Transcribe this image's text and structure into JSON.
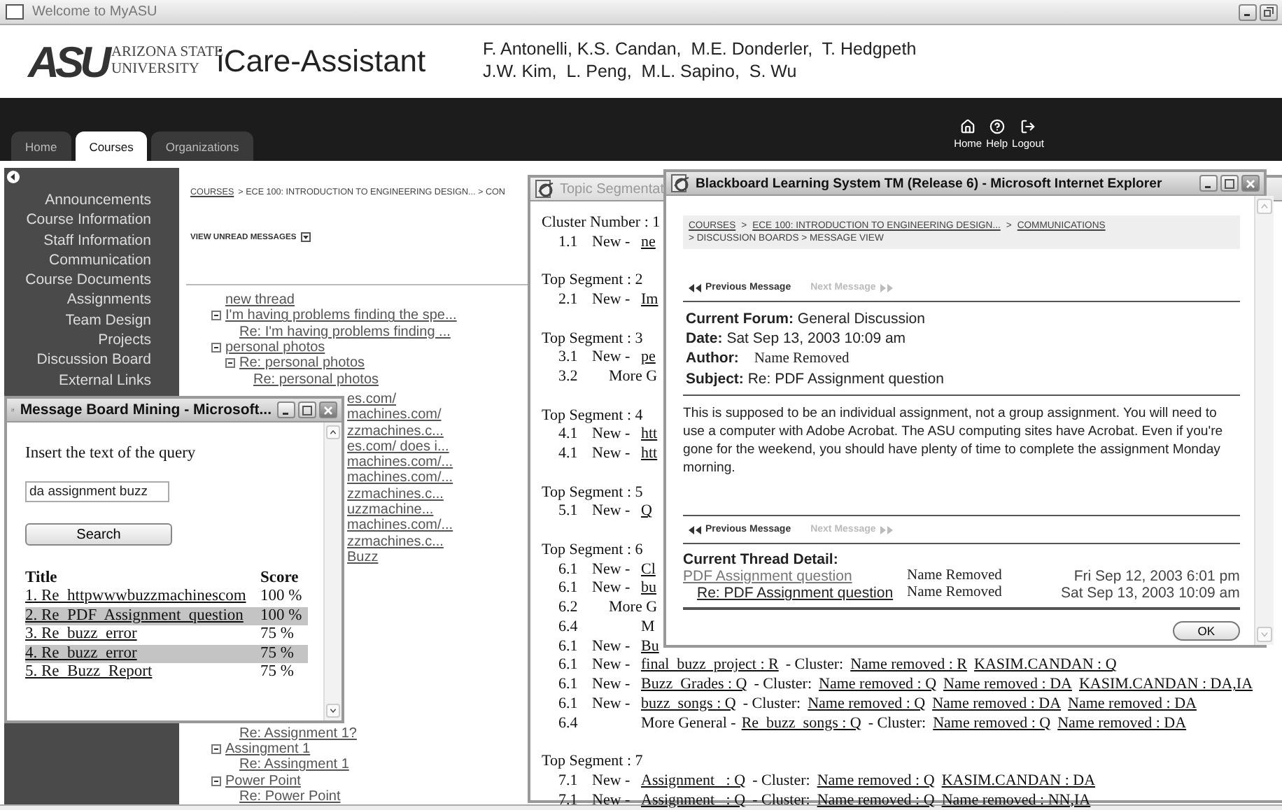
{
  "window": {
    "title": "Welcome to MyASU"
  },
  "header": {
    "logo": {
      "mark": "ASU",
      "lines": [
        "ARIZONA STATE",
        "UNIVERSITY"
      ]
    },
    "app_title": "iCare-Assistant",
    "authors": [
      "F. Antonelli, K.S. Candan,  M.E. Donderler,  T. Hedgpeth",
      "J.W. Kim,  L. Peng,  M.L. Sapino,  S. Wu"
    ]
  },
  "nav": {
    "tabs": [
      {
        "label": "Home",
        "selected": false
      },
      {
        "label": "Courses",
        "selected": true
      },
      {
        "label": "Organizations",
        "selected": false
      }
    ],
    "links": [
      {
        "kind": "home",
        "label": "Home"
      },
      {
        "kind": "help",
        "label": "Help"
      },
      {
        "kind": "logout",
        "label": "Logout"
      }
    ]
  },
  "sidebar": {
    "items": [
      "Announcements",
      "Course Information",
      "Staff Information",
      "Communication",
      "Course Documents",
      "Assignments",
      "Team Design Projects",
      "Discussion Board",
      "External Links"
    ]
  },
  "content": {
    "breadcrumb": [
      {
        "text": "COURSES",
        "link": true
      },
      {
        "text": "> ECE 100: INTRODUCTION TO ENGINEERING DESIGN... > CON",
        "link": false
      }
    ],
    "view_unread": "VIEW UNREAD MESSAGES",
    "threads": [
      {
        "text": "new thread"
      },
      {
        "text": "I'm having problems finding the spe...",
        "expanded": true,
        "children": [
          {
            "text": "Re: I'm having problems finding ..."
          }
        ]
      },
      {
        "text": "personal photos",
        "expanded": true,
        "children": [
          {
            "text": "Re: personal photos",
            "expanded": true,
            "children": [
              {
                "text": "Re: personal photos"
              }
            ]
          }
        ]
      }
    ],
    "cut_rows": [
      "es.com/",
      "machines.com/",
      "zzmachines.c...",
      "es.com/ does i...",
      "machines.com/...",
      "machines.com/...",
      "zzmachines.c...",
      "uzzmachine...",
      "machines.com/...",
      "zzmachines.c...",
      "Buzz"
    ],
    "continued_replies": [
      "Re: Assignment 1?"
    ],
    "bottom_threads": [
      {
        "text": "Assingment 1",
        "expanded": true,
        "children": [
          {
            "text": "Re: Assingment 1"
          }
        ]
      },
      {
        "text": "Power Point",
        "expanded": true,
        "children": [
          {
            "text": "Re: Power Point"
          }
        ]
      }
    ]
  },
  "topic_window": {
    "title": "Topic Segmentat",
    "rows": [
      {
        "kind": "heading",
        "text": "Cluster Number : 1"
      },
      {
        "kind": "new",
        "number": "1.1",
        "label": "New -",
        "parts": [
          {
            "text": "ne",
            "link": true
          }
        ]
      },
      {
        "kind": "heading",
        "text": "Top Segment : 2"
      },
      {
        "kind": "new",
        "number": "2.1",
        "label": "New -",
        "parts": [
          {
            "text": "Im",
            "link": true
          }
        ]
      },
      {
        "kind": "heading",
        "text": "Top Segment : 3"
      },
      {
        "kind": "new",
        "number": "3.1",
        "label": "New -",
        "parts": [
          {
            "text": "pe",
            "link": true
          }
        ]
      },
      {
        "kind": "more",
        "number": "3.2",
        "label": "More G"
      },
      {
        "kind": "heading",
        "text": "Top Segment : 4"
      },
      {
        "kind": "new",
        "number": "4.1",
        "label": "New -",
        "parts": [
          {
            "text": "htt",
            "link": true
          }
        ]
      },
      {
        "kind": "new",
        "number": "4.1",
        "label": "New -",
        "parts": [
          {
            "text": "htt",
            "link": true
          }
        ]
      },
      {
        "kind": "heading",
        "text": "Top Segment : 5"
      },
      {
        "kind": "new",
        "number": "5.1",
        "label": "New -",
        "parts": [
          {
            "text": "Q",
            "link": true
          }
        ]
      },
      {
        "kind": "heading",
        "text": "Top Segment : 6"
      },
      {
        "kind": "new",
        "number": "6.1",
        "label": "New -",
        "parts": [
          {
            "text": "Cl",
            "link": true
          }
        ]
      },
      {
        "kind": "new",
        "number": "6.1",
        "label": "New -",
        "parts": [
          {
            "text": "bu",
            "link": true
          }
        ]
      },
      {
        "kind": "more",
        "number": "6.2",
        "label": "More G"
      },
      {
        "kind": "general",
        "number": "6.4",
        "label": "M"
      },
      {
        "kind": "new",
        "number": "6.1",
        "label": "New -",
        "parts": [
          {
            "text": "Bu",
            "link": true
          }
        ]
      },
      {
        "kind": "new",
        "number": "6.1",
        "label": "New -",
        "parts": [
          {
            "text": "final  buzz  project : R",
            "link": true
          },
          {
            "text": "- Cluster:",
            "link": false
          },
          {
            "text": "Name removed : R",
            "link": true
          },
          {
            "text": "KASIM.CANDAN : Q",
            "link": true
          }
        ]
      },
      {
        "kind": "new",
        "number": "6.1",
        "label": "New -",
        "parts": [
          {
            "text": "Buzz  Grades : Q",
            "link": true
          },
          {
            "text": "- Cluster:",
            "link": false
          },
          {
            "text": "Name removed : Q",
            "link": true
          },
          {
            "text": "Name removed : DA",
            "link": true
          },
          {
            "text": "KASIM.CANDAN : DA,IA",
            "link": true
          }
        ]
      },
      {
        "kind": "new",
        "number": "6.1",
        "label": "New -",
        "parts": [
          {
            "text": "buzz  songs : Q",
            "link": true
          },
          {
            "text": "- Cluster:",
            "link": false
          },
          {
            "text": "Name removed : Q",
            "link": true
          },
          {
            "text": "Name removed : DA",
            "link": true
          },
          {
            "text": "Name removed : DA",
            "link": true
          }
        ]
      },
      {
        "kind": "general",
        "number": "6.4",
        "label": "More General -",
        "parts": [
          {
            "text": "Re  buzz  songs : Q",
            "link": true
          },
          {
            "text": "- Cluster:",
            "link": false
          },
          {
            "text": "Name removed : Q",
            "link": true
          },
          {
            "text": "Name removed : DA",
            "link": true
          }
        ]
      },
      {
        "kind": "heading",
        "text": "Top Segment : 7"
      },
      {
        "kind": "new",
        "number": "7.1",
        "label": "New -",
        "parts": [
          {
            "text": "Assignment   : Q",
            "link": true
          },
          {
            "text": "- Cluster:",
            "link": false
          },
          {
            "text": "Name removed : Q",
            "link": true
          },
          {
            "text": "KASIM.CANDAN : DA",
            "link": true
          }
        ]
      },
      {
        "kind": "new",
        "number": "7.1",
        "label": "New -",
        "parts": [
          {
            "text": "Assignment   : Q",
            "link": true
          },
          {
            "text": "- Cluster:",
            "link": false
          },
          {
            "text": "Name removed : Q",
            "link": true
          },
          {
            "text": "Name removed : NN,IA",
            "link": true
          }
        ]
      }
    ]
  },
  "message_window": {
    "title": "Blackboard Learning System TM (Release 6) - Microsoft Internet Explorer",
    "breadcrumb": [
      {
        "text": "COURSES",
        "link": true
      },
      {
        "text": ">",
        "link": false
      },
      {
        "text": "ECE 100: INTRODUCTION TO ENGINEERING DESIGN...",
        "link": true
      },
      {
        "text": ">",
        "link": false
      },
      {
        "text": "COMMUNICATIONS",
        "link": true
      },
      {
        "text": "> DISCUSSION BOARDS > MESSAGE VIEW",
        "link": false
      }
    ],
    "pager_top": [
      {
        "kind": "previous",
        "label": "Previous Message",
        "disabled": false
      },
      {
        "kind": "next",
        "label": "Next Message",
        "disabled": true
      }
    ],
    "fields": [
      {
        "label": "Current Forum:",
        "value": "General Discussion"
      },
      {
        "label": "Date:",
        "value": "Sat Sep 13, 2003 10:09 am"
      },
      {
        "label": "Author:",
        "value": "Name Removed"
      },
      {
        "label": "Subject:",
        "value": "Re: PDF Assignment question"
      }
    ],
    "body": "This is supposed to be an individual assignment, not a group assignment. You will need to use a computer with Adobe Acrobat. The ASU computing sites have Acrobat. Even if you're gone for the weekend, you should have plenty of time to complete the assignment Monday morning.",
    "pager_bottom": [
      {
        "kind": "previous",
        "label": "Previous Message",
        "disabled": false
      },
      {
        "kind": "next",
        "label": "Next Message",
        "disabled": true
      }
    ],
    "thread_heading": "Current Thread Detail:",
    "thread": [
      {
        "title": "PDF Assignment question",
        "author": "Name Removed",
        "date": "Fri Sep 12, 2003 6:01 pm",
        "reply": false,
        "current": false
      },
      {
        "title": "Re: PDF Assignment question",
        "author": "Name Removed",
        "date": "Sat Sep 13, 2003 10:09 am",
        "reply": true,
        "current": true
      }
    ],
    "ok_button": "OK"
  },
  "mining_window": {
    "title": "Message Board Mining - Microsoft...",
    "prompt": "Insert the text of the query",
    "query": "da assignment buzz",
    "search_button": "Search",
    "columns": [
      "Title",
      "Score"
    ],
    "results": [
      {
        "title": "1. Re  httpwwwbuzzmachinescom",
        "score": "100 %",
        "selected": false
      },
      {
        "title": "2. Re  PDF  Assignment  question",
        "score": "100 %",
        "selected": true
      },
      {
        "title": "3. Re  buzz  error",
        "score": "75 %",
        "selected": false
      },
      {
        "title": "4. Re  buzz  error",
        "score": "75 %",
        "selected": true
      },
      {
        "title": "5. Re  Buzz  Report",
        "score": "75 %",
        "selected": false
      }
    ]
  }
}
